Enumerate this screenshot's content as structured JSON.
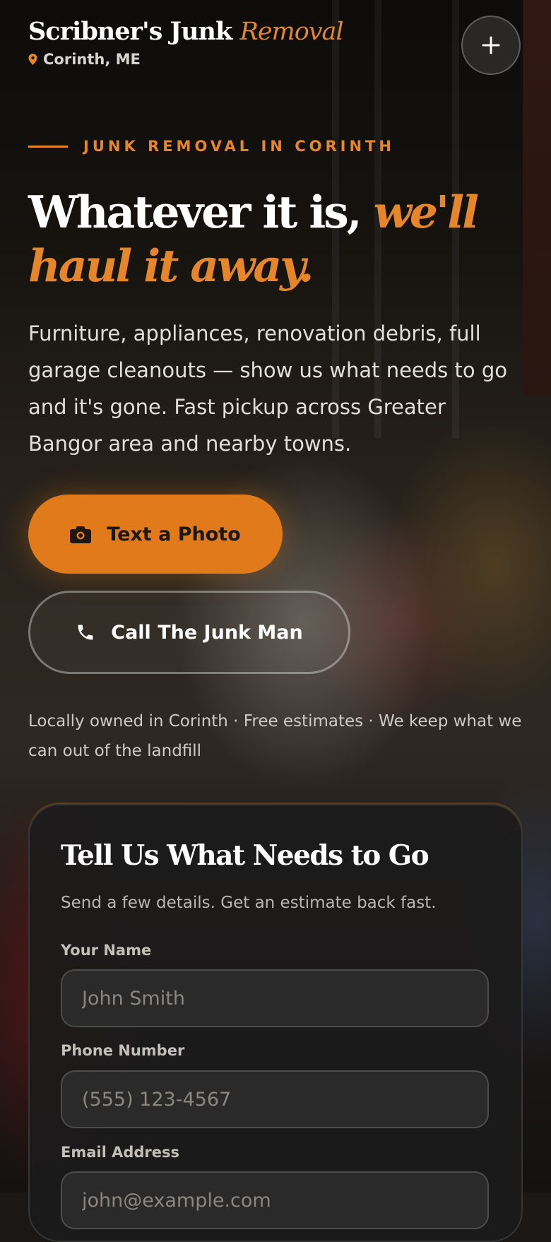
{
  "header": {
    "brand_main": "Scribner's Junk ",
    "brand_accent": "Removal",
    "location": "Corinth, ME",
    "plus_icon": "plus-icon"
  },
  "hero": {
    "eyebrow": "JUNK REMOVAL IN CORINTH",
    "headline_plain": "Whatever it is, ",
    "headline_accent": "we'll haul it away.",
    "lede": "Furniture, appliances, renovation debris, full garage cleanouts — show us what needs to go and it's gone. Fast pickup across Greater Bangor area and nearby towns.",
    "cta_photo": "Text a Photo",
    "cta_call": "Call The Junk Man",
    "trust_line": "Locally owned in Corinth · Free estimates · We keep what we can out of the landfill"
  },
  "form": {
    "title": "Tell Us What Needs to Go",
    "subtitle": "Send a few details. Get an estimate back fast.",
    "name_label": "Your Name",
    "name_placeholder": "John Smith",
    "phone_label": "Phone Number",
    "phone_placeholder": "(555) 123-4567",
    "email_label": "Email Address",
    "email_placeholder": "john@example.com"
  },
  "colors": {
    "accent": "#e6862a",
    "button": "#e17a1a"
  }
}
